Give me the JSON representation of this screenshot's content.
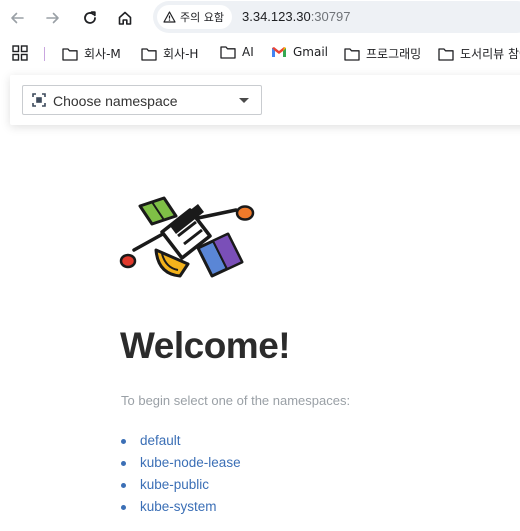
{
  "browser": {
    "security_chip": "주의 요함",
    "url_host": "3.34.123.30",
    "url_port": ":30797",
    "bookmarks": [
      {
        "label": "회사-M",
        "icon": "folder-icon"
      },
      {
        "label": "회사-H",
        "icon": "folder-icon"
      },
      {
        "label": "AI",
        "icon": "folder-icon"
      },
      {
        "label": "Gmail",
        "icon": "gmail-icon"
      },
      {
        "label": "프로그래밍",
        "icon": "folder-icon"
      },
      {
        "label": "도서리뷰 참여",
        "icon": "folder-icon"
      }
    ]
  },
  "header": {
    "namespace_select": {
      "placeholder": "Choose namespace"
    }
  },
  "main": {
    "title": "Welcome!",
    "subtitle": "To begin select one of the namespaces:",
    "namespaces": [
      "default",
      "kube-node-lease",
      "kube-public",
      "kube-system"
    ]
  },
  "colors": {
    "link": "#3b6fb6",
    "title": "#2b2b2b",
    "subtitle": "#9aa0a6",
    "omnibox_bg": "#eef1f5"
  }
}
